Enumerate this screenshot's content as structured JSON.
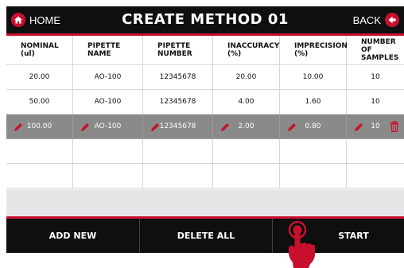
{
  "header": {
    "home_label": "HOME",
    "title": "CREATE METHOD 01",
    "back_label": "BACK"
  },
  "table": {
    "columns": [
      [
        "NOMINAL",
        "(ul)"
      ],
      [
        "PIPETTE",
        "NAME"
      ],
      [
        "PIPETTE",
        "NUMBER"
      ],
      [
        "INACCURACY",
        "(%)"
      ],
      [
        "IMPRECISION",
        "(%)"
      ],
      [
        "NUMBER OF",
        "SAMPLES"
      ]
    ],
    "rows": [
      [
        "20.00",
        "AO-100",
        "12345678",
        "20.00",
        "10.00",
        "10"
      ],
      [
        "50.00",
        "AO-100",
        "12345678",
        "4.00",
        "1.60",
        "10"
      ],
      [
        "100.00",
        "AO-100",
        "12345678",
        "2.00",
        "0.80",
        "10"
      ]
    ],
    "selected_row": 2
  },
  "footer": {
    "add_new": "ADD NEW",
    "delete_all": "DELETE ALL",
    "start": "START"
  },
  "colors": {
    "accent": "#c8102e",
    "header_bg": "#0f0f0f",
    "selected_row_bg": "#8a8a8a",
    "grid_line": "#d6d6d6"
  },
  "icons": {
    "home": "home-icon",
    "back": "back-arrow-icon",
    "edit": "pencil-icon",
    "delete": "trash-icon",
    "start": "power-icon",
    "pointer": "hand-pointer-icon"
  }
}
